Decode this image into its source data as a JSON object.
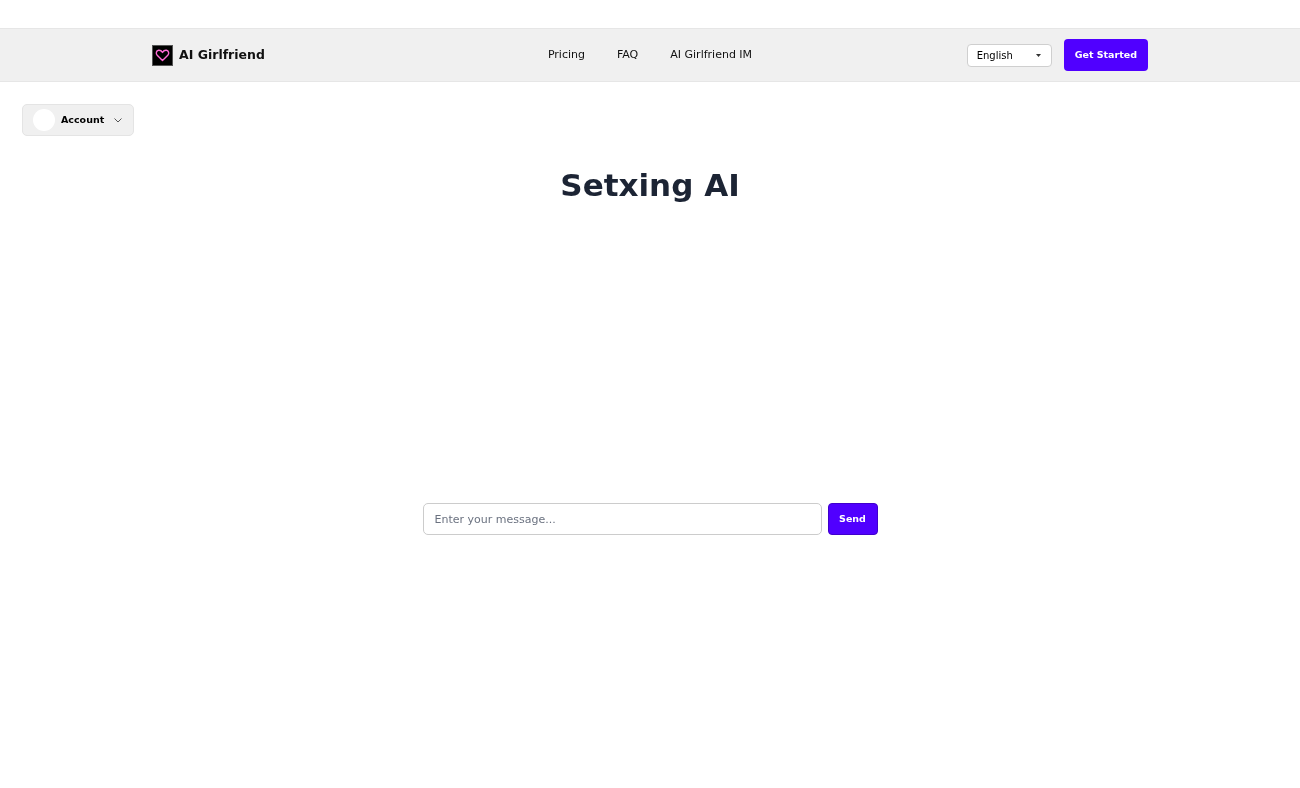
{
  "header": {
    "logo_text": "AI Girlfriend",
    "nav_links": [
      {
        "label": "Pricing"
      },
      {
        "label": "FAQ"
      },
      {
        "label": "AI Girlfriend IM"
      }
    ],
    "language_select": {
      "value": "English"
    },
    "cta_button": "Get Started"
  },
  "account_menu": {
    "label": "Account"
  },
  "title": "Setxing AI",
  "chat_input": {
    "placeholder": "Enter your message...",
    "send_button": "Send"
  }
}
